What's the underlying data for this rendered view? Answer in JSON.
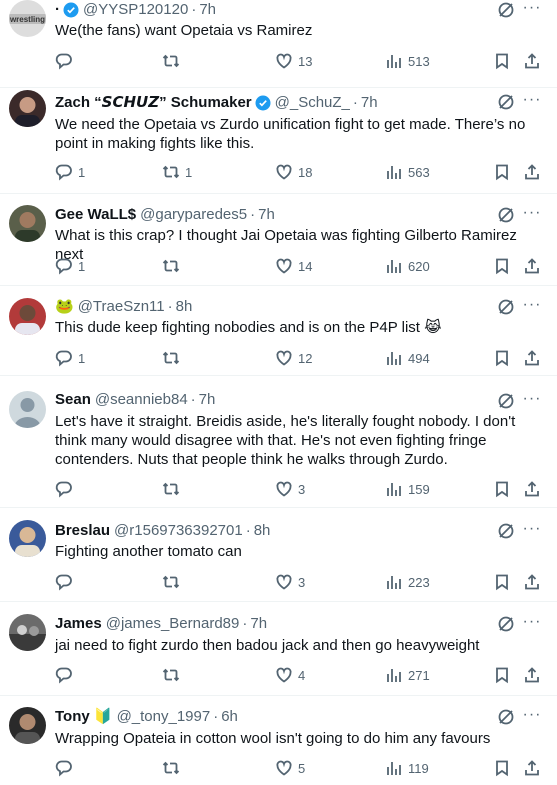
{
  "tweets": [
    {
      "name": "·",
      "handle": "@YYSP120120",
      "time": "7h",
      "text": "We(the fans) want Opetaia vs Ramirez",
      "avatar_label": "wrestling",
      "verified": true,
      "replies": "",
      "retweets": "",
      "likes": "13",
      "views": "513"
    },
    {
      "name": "Zach “𝙎𝘾𝙃𝙐𝙕” Schumaker",
      "handle": "@_SchuZ_",
      "time": "7h",
      "text": "We need the Opetaia vs Zurdo unification fight to get made. There’s no point in making fights like this.",
      "verified": true,
      "replies": "1",
      "retweets": "1",
      "likes": "18",
      "views": "563"
    },
    {
      "name": "Gee WaLL$",
      "handle": "@garyparedes5",
      "time": "7h",
      "text": "What is this crap? I thought Jai Opetaia was fighting Gilberto Ramirez next",
      "verified": false,
      "replies": "1",
      "retweets": "",
      "likes": "14",
      "views": "620"
    },
    {
      "name": "🐸",
      "handle": "@TraeSzn11",
      "time": "8h",
      "text": "This dude keep fighting nobodies and is on the P4P list 😹",
      "verified": false,
      "replies": "1",
      "retweets": "",
      "likes": "12",
      "views": "494"
    },
    {
      "name": "Sean",
      "handle": "@seannieb84",
      "time": "7h",
      "text": "Let's have it straight. Breidis aside, he's literally fought nobody. I don't think many would disagree with that. He's not even fighting fringe contenders. Nuts that people think he walks through Zurdo.",
      "verified": false,
      "replies": "",
      "retweets": "",
      "likes": "3",
      "views": "159"
    },
    {
      "name": "Breslau",
      "handle": "@r1569736392701",
      "time": "8h",
      "text": "Fighting another tomato can",
      "verified": false,
      "replies": "",
      "retweets": "",
      "likes": "3",
      "views": "223"
    },
    {
      "name": "James",
      "handle": "@james_Bernard89",
      "time": "7h",
      "text": "jai need to fight zurdo then badou jack and then go heavyweight",
      "verified": false,
      "replies": "",
      "retweets": "",
      "likes": "4",
      "views": "271"
    },
    {
      "name": "Tony 🔰",
      "handle": "@_tony_1997",
      "time": "6h",
      "text": "Wrapping Opateia in cotton wool isn't going to do him any favours",
      "verified": false,
      "replies": "",
      "retweets": "",
      "likes": "5",
      "views": "119"
    }
  ],
  "colors": {
    "text": "#0f1419",
    "secondary": "#536471",
    "verified": "#1d9bf0",
    "divider": "#eff3f4"
  },
  "icons": [
    "reply-icon",
    "retweet-icon",
    "like-icon",
    "views-icon",
    "bookmark-icon",
    "share-icon",
    "grok-icon",
    "more-icon",
    "verified-badge-icon"
  ]
}
